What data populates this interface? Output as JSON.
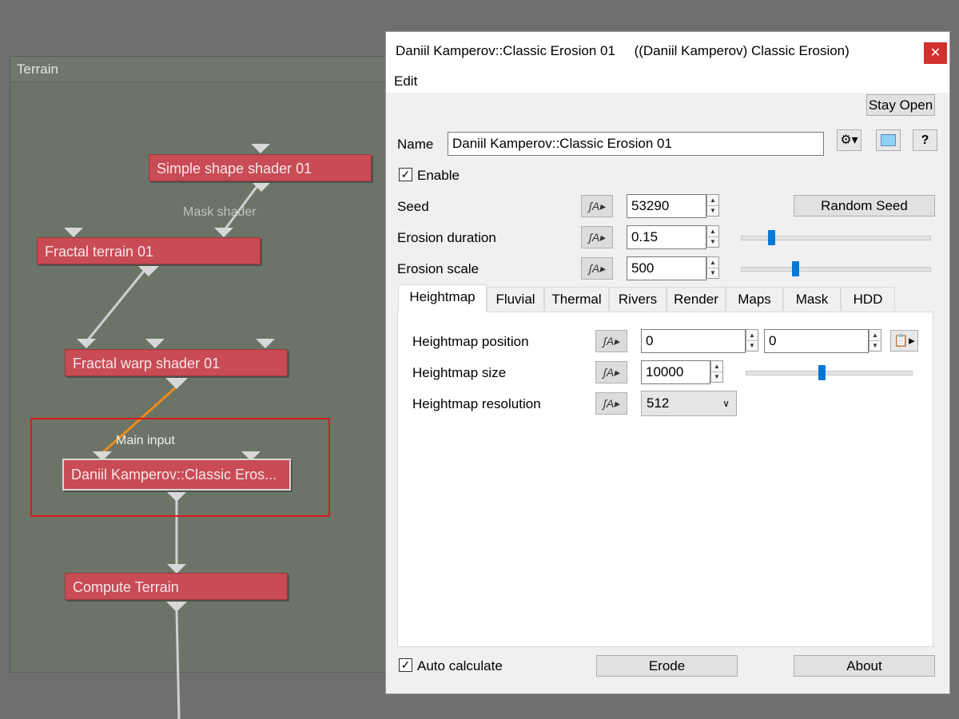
{
  "graph": {
    "panel_title": "Terrain",
    "nodes": {
      "simple_shape": "Simple shape shader 01",
      "fractal_terrain": "Fractal terrain 01",
      "fractal_warp": "Fractal warp shader 01",
      "classic_erosion": "Daniil Kamperov::Classic Eros...",
      "compute_terrain": "Compute Terrain"
    },
    "edge_labels": {
      "mask_shader": "Mask shader",
      "main_input": "Main input"
    }
  },
  "dialog": {
    "title": "Daniil Kamperov::Classic Erosion 01     ((Daniil Kamperov) Classic Erosion)",
    "close_icon": "close-icon",
    "menu_edit": "Edit",
    "stay_open": "Stay Open",
    "name_label": "Name",
    "name_value": "Daniil Kamperov::Classic Erosion 01",
    "enable_label": "Enable",
    "enable_checked": true,
    "seed_label": "Seed",
    "seed_value": "53290",
    "random_seed": "Random Seed",
    "erosion_duration_label": "Erosion duration",
    "erosion_duration_value": "0.15",
    "erosion_duration_slider": 0.16,
    "erosion_scale_label": "Erosion scale",
    "erosion_scale_value": "500",
    "erosion_scale_slider": 0.29,
    "tabs": [
      "Heightmap",
      "Fluvial",
      "Thermal",
      "Rivers",
      "Render",
      "Maps",
      "Mask",
      "HDD"
    ],
    "active_tab": "Heightmap",
    "hm_position_label": "Heightmap position",
    "hm_position_x": "0",
    "hm_position_y": "0",
    "hm_size_label": "Heightmap size",
    "hm_size_value": "10000",
    "hm_size_slider": 0.46,
    "hm_resolution_label": "Heightmap resolution",
    "hm_resolution_value": "512",
    "auto_calc_label": "Auto calculate",
    "auto_calc_checked": true,
    "erode_button": "Erode",
    "about_button": "About"
  }
}
